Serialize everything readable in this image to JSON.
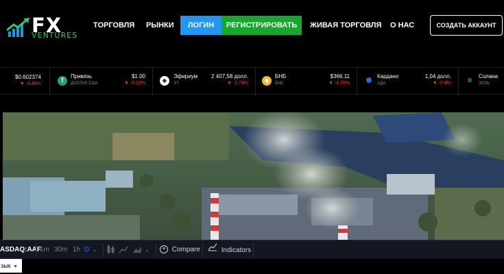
{
  "brand": {
    "name_main": "FX",
    "name_sub": "VENTURES",
    "accent": "#3cc36b"
  },
  "nav": {
    "trade": "ТОРГОВЛЯ",
    "markets": "РЫНКИ",
    "login": "ЛОГИН",
    "register": "РЕГИСТРИРОВАТЬ",
    "live": "ЖИВАЯ ТОРГОВЛЯ",
    "about": "О НАС",
    "create_account": "СОЗДАТЬ АККАУНТ"
  },
  "ticker": {
    "first": {
      "price": "$0.602374",
      "change": "-3.49%"
    },
    "items": [
      {
        "icon": "tether-icon",
        "name": "Привязь",
        "sub": "ДОЛЛАР США",
        "price": "$1.00",
        "change": "-0.02%"
      },
      {
        "icon": "ethereum-icon",
        "name": "Эфириум",
        "sub": "ЭТ",
        "price": "2 407,58 долл.",
        "change": "-2.73%"
      },
      {
        "icon": "bnb-icon",
        "name": "БНБ",
        "sub": "БНБ",
        "price": "$366.11",
        "change": "-4.35%"
      },
      {
        "icon": "cardano-icon",
        "name": "Кардано",
        "sub": "АДА",
        "price": "1,04 долл.",
        "change": "-0.8%"
      },
      {
        "icon": "solana-icon",
        "name": "Солана",
        "sub": "ЗОЛЬ"
      }
    ]
  },
  "toolbar": {
    "symbol": "ASDAQ:AAF",
    "intervals": [
      "1m",
      "30m",
      "1h"
    ],
    "active_interval": "D",
    "compare": "Compare",
    "indicators": "Indicators"
  },
  "language": {
    "label": "зык",
    "arrow": "▼"
  }
}
